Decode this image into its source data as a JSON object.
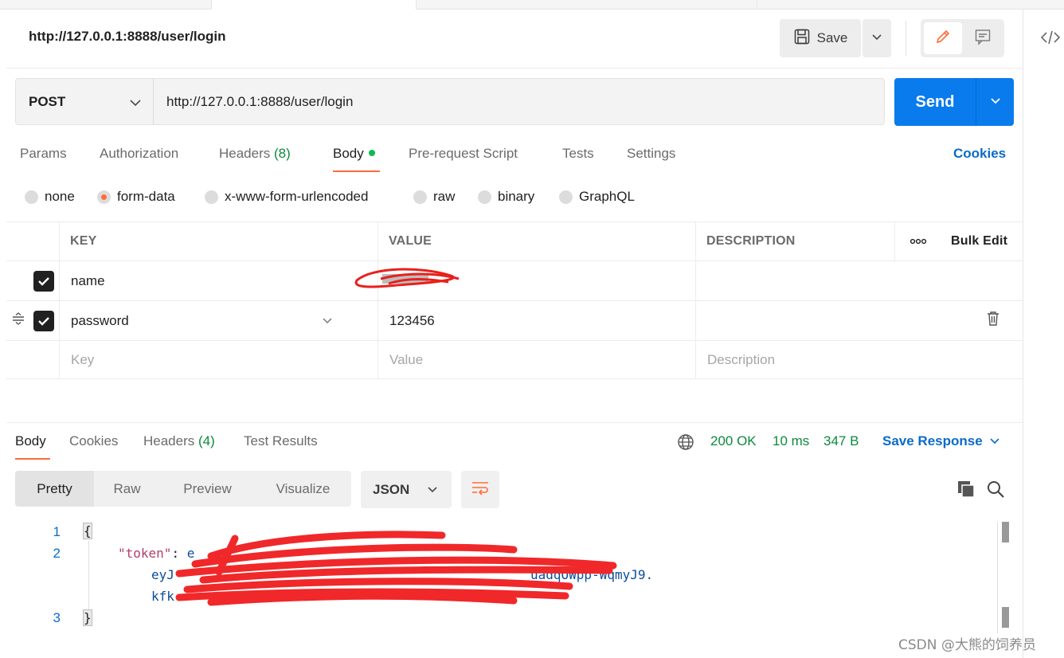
{
  "request": {
    "title": "http://127.0.0.1:8888/user/login",
    "save_label": "Save",
    "method": "POST",
    "url": "http://127.0.0.1:8888/user/login",
    "send_label": "Send"
  },
  "tabs": [
    {
      "label": "Params"
    },
    {
      "label": "Authorization"
    },
    {
      "label": "Headers",
      "count": "(8)"
    },
    {
      "label": "Body"
    },
    {
      "label": "Pre-request Script"
    },
    {
      "label": "Tests"
    },
    {
      "label": "Settings"
    }
  ],
  "cookies_label": "Cookies",
  "body_types": [
    {
      "label": "none"
    },
    {
      "label": "form-data",
      "selected": true
    },
    {
      "label": "x-www-form-urlencoded"
    },
    {
      "label": "raw"
    },
    {
      "label": "binary"
    },
    {
      "label": "GraphQL"
    }
  ],
  "table": {
    "headers": {
      "key": "KEY",
      "value": "VALUE",
      "description": "DESCRIPTION",
      "more": "ooo",
      "bulk_edit": "Bulk Edit"
    },
    "rows": [
      {
        "key": "name",
        "value": "",
        "description": ""
      },
      {
        "key": "password",
        "value": "123456",
        "description": ""
      }
    ],
    "placeholders": {
      "key": "Key",
      "value": "Value",
      "description": "Description"
    }
  },
  "response": {
    "tabs": [
      {
        "label": "Body"
      },
      {
        "label": "Cookies"
      },
      {
        "label": "Headers",
        "count": "(4)"
      },
      {
        "label": "Test Results"
      }
    ],
    "status": "200 OK",
    "time": "10 ms",
    "size": "347 B",
    "save_response_label": "Save Response",
    "views": [
      "Pretty",
      "Raw",
      "Preview",
      "Visualize"
    ],
    "format": "JSON",
    "code": {
      "line_numbers": [
        "1",
        "2",
        "3"
      ],
      "open_brace": "{",
      "close_brace": "}",
      "key": "\"token\"",
      "colon": ": ",
      "token_part1": "e",
      "token_part2": "eyJ",
      "token_part2_tail": "uadqOWpp-WqmyJ9.",
      "token_part3": "kfk"
    }
  },
  "watermark": "CSDN @大熊的饲养员",
  "colors": {
    "accent": "#ff6c37",
    "send": "#097bed",
    "link": "#0b6bc9",
    "ok": "#0c8a3e"
  }
}
